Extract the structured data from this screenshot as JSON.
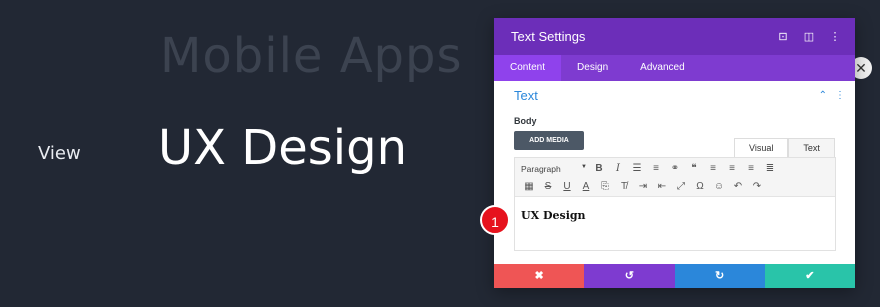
{
  "background": {
    "heading_faded": "Mobile Apps",
    "view_label": "View",
    "main_heading": "UX Design"
  },
  "modal": {
    "title": "Text Settings",
    "header_icons": [
      "focus-icon",
      "columns-icon",
      "more-vert-icon"
    ],
    "tabs": [
      {
        "label": "Content",
        "active": true
      },
      {
        "label": "Design",
        "active": false
      },
      {
        "label": "Advanced",
        "active": false
      }
    ],
    "section": {
      "title": "Text"
    },
    "body_label": "Body",
    "add_media": "ADD MEDIA",
    "editor_tabs": [
      {
        "label": "Visual",
        "active": true
      },
      {
        "label": "Text",
        "active": false
      }
    ],
    "format_select": "Paragraph",
    "content": "UX Design"
  },
  "badge": {
    "number": "1"
  },
  "colors": {
    "page_bg": "#222834",
    "header": "#6c2eb9",
    "tabs_bar": "#7e3bd0",
    "active_tab": "#8f42ec",
    "accent_blue": "#2b87da",
    "cancel": "#ef5555",
    "undo": "#7e3bd0",
    "redo": "#2b87da",
    "save": "#29c4a9",
    "badge": "#e6121d"
  }
}
